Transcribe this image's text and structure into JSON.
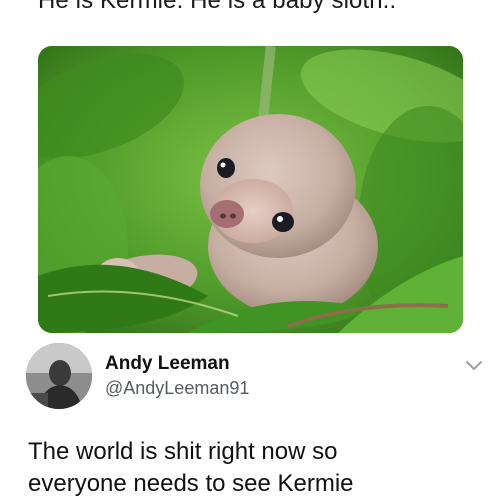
{
  "caption": {
    "text": "He is Kermie. He is a baby sloth.."
  },
  "media": {
    "subject": "baby sloth on leaves",
    "background_color": "#4f9a2a",
    "fur_color": "#c7aea3"
  },
  "tweet": {
    "author": {
      "display_name": "Andy Leeman",
      "handle": "@AndyLeeman91"
    },
    "menu_icon": "chevron-down-icon",
    "text_lines": [
      "The world is shit right now so",
      "everyone needs to see Kermie"
    ]
  }
}
